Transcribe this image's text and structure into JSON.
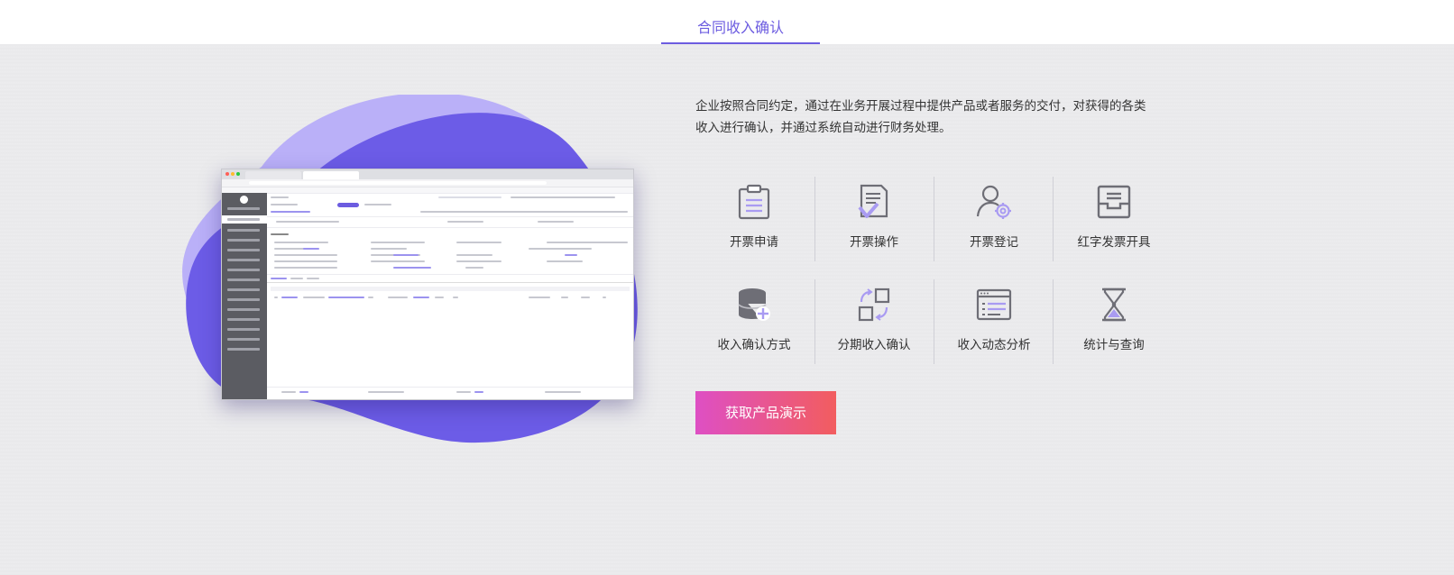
{
  "tabs": {
    "active_label": "合同收入确认"
  },
  "description": {
    "line1": "企业按照合同约定，通过在业务开展过程中提供产品或者服务的交付，对获得的各类",
    "line2": "收入进行确认，并通过系统自动进行财务处理。"
  },
  "features": [
    {
      "label": "开票申请",
      "icon": "clipboard-icon"
    },
    {
      "label": "开票操作",
      "icon": "document-check-icon"
    },
    {
      "label": "开票登记",
      "icon": "user-gear-icon"
    },
    {
      "label": "红字发票开具",
      "icon": "inbox-tray-icon"
    },
    {
      "label": "收入确认方式",
      "icon": "database-plus-icon"
    },
    {
      "label": "分期收入确认",
      "icon": "shapes-transfer-icon"
    },
    {
      "label": "收入动态分析",
      "icon": "browser-window-icon"
    },
    {
      "label": "统计与查询",
      "icon": "hourglass-icon"
    }
  ],
  "cta": {
    "label": "获取产品演示"
  },
  "colors": {
    "accent": "#6c5ce0",
    "blob_light": "#bab0f8",
    "blob_dark": "#6c5ce7",
    "icon_gray": "#6e6e76",
    "icon_purple": "#a99bf2",
    "cta_start": "#de4fc4",
    "cta_end": "#f25d5f"
  }
}
